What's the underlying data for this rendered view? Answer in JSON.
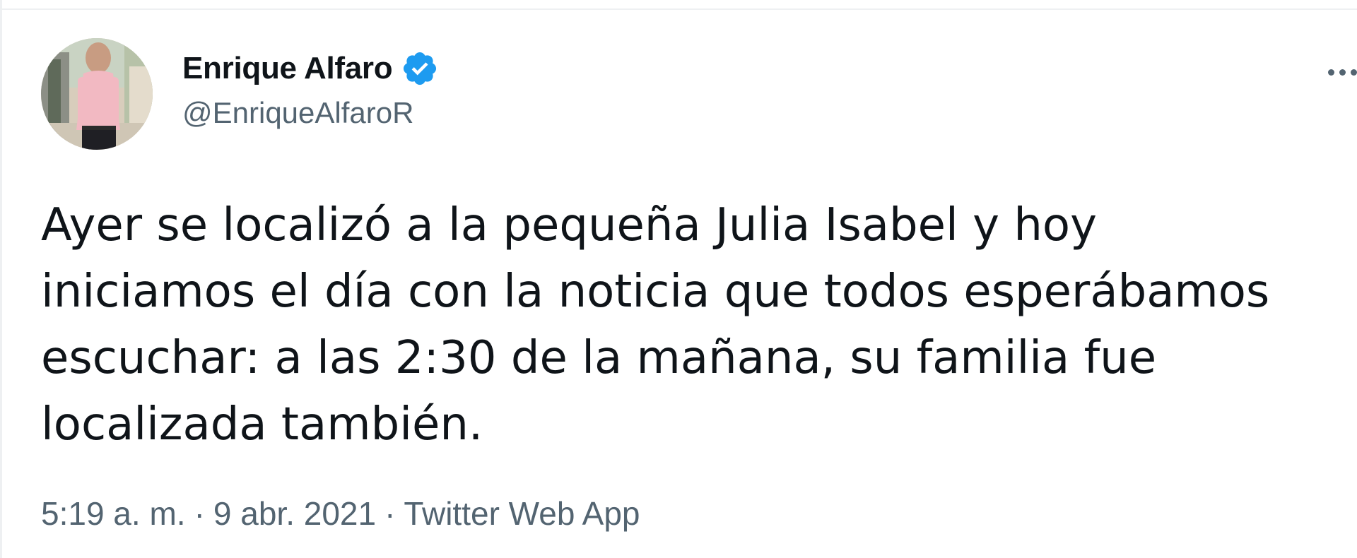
{
  "author": {
    "display_name": "Enrique Alfaro",
    "handle": "@EnriqueAlfaroR",
    "verified": true,
    "verified_color": "#1d9bf0"
  },
  "tweet": {
    "text": "Ayer se localizó a la pequeña Julia Isabel y hoy\niniciamos el día con la noticia que todos esperábamos\nescuchar: a las 2:30 de la mañana, su familia fue\nlocalizada también.",
    "time": "5:19 a. m.",
    "separator": "·",
    "date": "9 abr. 2021",
    "source": "Twitter Web App"
  },
  "icons": {
    "more": "more-options-icon",
    "verified": "verified-badge-icon"
  },
  "colors": {
    "text": "#0f1419",
    "secondary": "#536471",
    "border": "#eef0f2"
  }
}
